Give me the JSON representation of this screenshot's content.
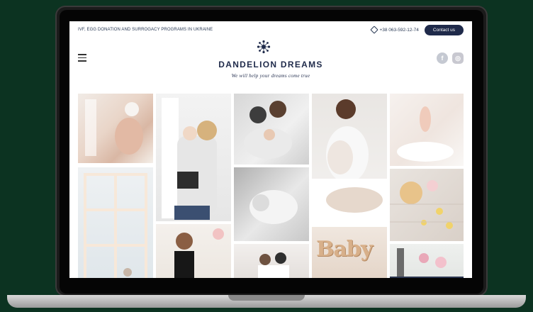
{
  "site": {
    "top_text": "IVF, EGG DONATION AND SURROGACY PROGRAMS IN UKRAINE",
    "phone": "+38 063-592-12-74",
    "contact_label": "Contact us",
    "brand": "DANDELION DREAMS",
    "tagline": "We will help your dreams come true",
    "social": [
      {
        "name": "facebook",
        "glyph": "f"
      },
      {
        "name": "instagram",
        "glyph": "◎"
      }
    ]
  },
  "gallery": {
    "photos": [
      {
        "name": "pregnant-woman-flowers",
        "caption": ""
      },
      {
        "name": "mother-child-window",
        "caption": ""
      },
      {
        "name": "family-hugging",
        "caption": ""
      },
      {
        "name": "pregnant-woman-white-dress",
        "caption": ""
      },
      {
        "name": "hands-white-bed",
        "caption": ""
      },
      {
        "name": "window-light-room",
        "caption": ""
      },
      {
        "name": "baby-sleeping-bw",
        "caption": ""
      },
      {
        "name": "woman-with-child",
        "caption": ""
      },
      {
        "name": "baby-flowers-floor",
        "caption": ""
      },
      {
        "name": "wooden-baby-letters",
        "caption": "Baby"
      },
      {
        "name": "couple-indoors",
        "caption": ""
      },
      {
        "name": "flowers-chair",
        "caption": ""
      }
    ]
  },
  "colors": {
    "background": "#0c3321",
    "brand_navy": "#1f2a4a",
    "social_grey": "#c5c9d2"
  }
}
